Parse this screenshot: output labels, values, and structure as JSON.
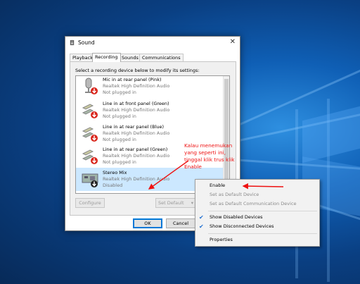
{
  "window": {
    "title": "Sound"
  },
  "tabs": [
    "Playback",
    "Recording",
    "Sounds",
    "Communications"
  ],
  "active_tab": "Recording",
  "instruction": "Select a recording device below to modify its settings:",
  "devices": [
    {
      "name": "Mic in at rear panel (Pink)",
      "driver": "Realtek High Definition Audio",
      "status": "Not plugged in",
      "icon": "microphone-icon"
    },
    {
      "name": "Line in at front panel (Green)",
      "driver": "Realtek High Definition Audio",
      "status": "Not plugged in",
      "icon": "line-in-jack-icon"
    },
    {
      "name": "Line in at rear panel (Blue)",
      "driver": "Realtek High Definition Audio",
      "status": "Not plugged in",
      "icon": "line-in-jack-icon"
    },
    {
      "name": "Line in at rear panel (Green)",
      "driver": "Realtek High Definition Audio",
      "status": "Not plugged in",
      "icon": "line-in-jack-icon"
    },
    {
      "name": "Stereo Mix",
      "driver": "Realtek High Definition Audio",
      "status": "Disabled",
      "icon": "circuit-board-icon"
    }
  ],
  "buttons": {
    "configure": "Configure",
    "set_default": "Set Default",
    "set_default_arrow": "▾",
    "ok": "OK",
    "cancel": "Cancel"
  },
  "annotation": "Kalau menemukan yang seperti ini, tinggal klik trus klik Enable",
  "context_menu": {
    "enable": "Enable",
    "set_default_device": "Set as Default Device",
    "set_default_comm": "Set as Default Communication Device",
    "show_disabled": "Show Disabled Devices",
    "show_disconnected": "Show Disconnected Devices",
    "properties": "Properties",
    "check_glyph": "✔"
  },
  "colors": {
    "annotation": "#ee1111",
    "selection": "#cce8ff",
    "desktop_blue": "#0f5fb5"
  }
}
